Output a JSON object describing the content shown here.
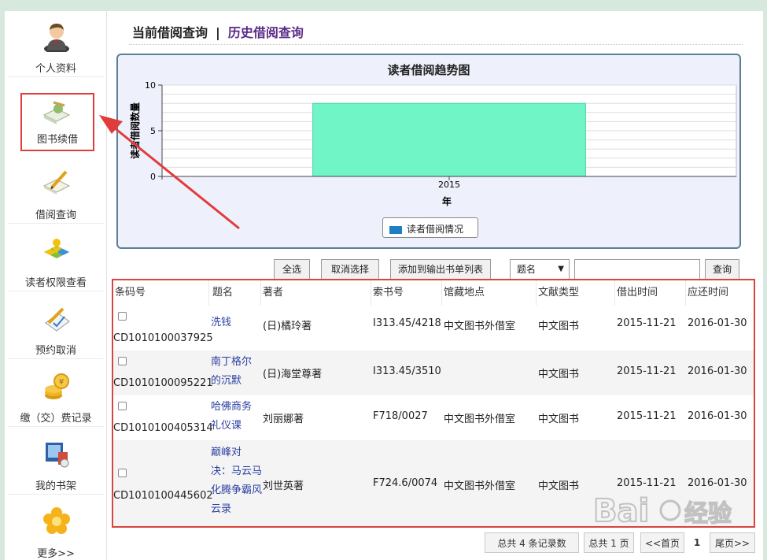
{
  "sidebar": {
    "items": [
      {
        "label": "个人资料",
        "icon": "user-avatar-icon"
      },
      {
        "label": "图书续借",
        "icon": "book-renew-icon"
      },
      {
        "label": "借阅查询",
        "icon": "borrow-query-icon"
      },
      {
        "label": "读者权限查看",
        "icon": "reader-permission-icon"
      },
      {
        "label": "预约取消",
        "icon": "reservation-cancel-icon"
      },
      {
        "label": "缴（交）费记录",
        "icon": "coins-icon"
      },
      {
        "label": "我的书架",
        "icon": "bookshelf-icon"
      },
      {
        "label": "更多>>",
        "icon": "flower-icon"
      }
    ]
  },
  "tabs": {
    "current": "当前借阅查询",
    "separator": "|",
    "history": "历史借阅查询"
  },
  "chart_data": {
    "type": "bar",
    "title": "读者借阅趋势图",
    "xlabel": "年",
    "ylabel": "读者借阅数量",
    "categories": [
      "2015"
    ],
    "series": [
      {
        "name": "读者借阅情况",
        "values": [
          8
        ]
      }
    ],
    "ylim": [
      0,
      10
    ],
    "yticks": [
      0,
      5,
      10
    ],
    "grid": true,
    "legend": "bottom-center",
    "bar_color": "#6ff5c6",
    "legend_color": "#1e7fc4"
  },
  "toolbar": {
    "select_all": "全选",
    "unselect": "取消选择",
    "add_to_list": "添加到输出书单列表",
    "field_select": "题名",
    "search_value": "",
    "query": "查询"
  },
  "table": {
    "headers": [
      "条码号",
      "题名",
      "著者",
      "索书号",
      "馆藏地点",
      "文献类型",
      "借出时间",
      "应还时间"
    ],
    "rows": [
      {
        "barcode": "CD1010100037925",
        "title": [
          "洗钱"
        ],
        "author": "(日)橘玲著",
        "callno": "I313.45/4218",
        "location": "中文图书外借室",
        "type": "中文图书",
        "out": "2015-11-21",
        "due": "2016-01-30"
      },
      {
        "barcode": "CD1010100095221",
        "title": [
          "南丁格尔",
          "的沉默"
        ],
        "author": "(日)海堂尊著",
        "callno": "I313.45/3510",
        "location": "",
        "type": "中文图书",
        "out": "2015-11-21",
        "due": "2016-01-30"
      },
      {
        "barcode": "CD1010100405314",
        "title": [
          "哈佛商务",
          "礼仪课"
        ],
        "author": "刘丽娜著",
        "callno": "F718/0027",
        "location": "中文图书外借室",
        "type": "中文图书",
        "out": "2015-11-21",
        "due": "2016-01-30"
      },
      {
        "barcode": "CD1010100445602",
        "title": [
          "巅峰对",
          "决：马云马",
          "化腾争霸风",
          "云录"
        ],
        "author": "刘世英著",
        "callno": "F724.6/0074",
        "location": "中文图书外借室",
        "type": "中文图书",
        "out": "2015-11-21",
        "due": "2016-01-30"
      }
    ]
  },
  "pager": {
    "total_records": "总共 4 条记录数",
    "total_pages": "总共 1 页",
    "first": "<<首页",
    "current": "1",
    "last": "尾页>>"
  },
  "watermark": {
    "text": "Bai经验"
  }
}
